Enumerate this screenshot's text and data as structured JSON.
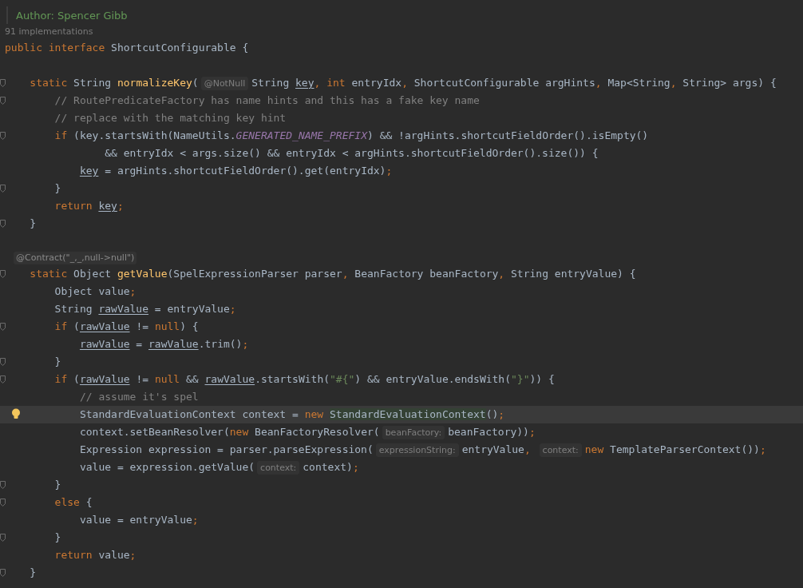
{
  "editor": {
    "lines": [
      {
        "kind": "doc",
        "text": "Author: Spencer Gibb"
      },
      {
        "kind": "lens",
        "text": "91 implementations"
      },
      {
        "kind": "code",
        "fold": false,
        "current": false,
        "bulb": false,
        "tokens": [
          {
            "text": "public interface",
            "kind": "kw"
          },
          {
            "text": " ShortcutConfigurable {",
            "kind": "p"
          }
        ]
      },
      {
        "kind": "blank"
      },
      {
        "kind": "code",
        "fold": true,
        "current": false,
        "bulb": false,
        "tokens": [
          {
            "text": "    static",
            "kind": "kw"
          },
          {
            "text": " String ",
            "kind": "p"
          },
          {
            "text": "normalizeKey",
            "kind": "fn"
          },
          {
            "text": "(",
            "kind": "p"
          },
          {
            "text": "@NotNull",
            "kind": "hint"
          },
          {
            "text": "String ",
            "kind": "p"
          },
          {
            "text": "key",
            "kind": "var"
          },
          {
            "text": ", ",
            "kind": "kw"
          },
          {
            "text": "int",
            "kind": "kw"
          },
          {
            "text": " entryIdx",
            "kind": "p"
          },
          {
            "text": ",",
            "kind": "kw"
          },
          {
            "text": " ShortcutConfigurable argHints",
            "kind": "p"
          },
          {
            "text": ",",
            "kind": "kw"
          },
          {
            "text": " Map<String",
            "kind": "p"
          },
          {
            "text": ",",
            "kind": "kw"
          },
          {
            "text": " String> args) {",
            "kind": "p"
          }
        ]
      },
      {
        "kind": "code",
        "fold": true,
        "current": false,
        "bulb": false,
        "tokens": [
          {
            "text": "        // RoutePredicateFactory has name hints and this has a fake key name",
            "kind": "cmt"
          }
        ]
      },
      {
        "kind": "code",
        "fold": false,
        "current": false,
        "bulb": false,
        "tokens": [
          {
            "text": "        // replace with the matching key hint",
            "kind": "cmt"
          }
        ]
      },
      {
        "kind": "code",
        "fold": true,
        "current": false,
        "bulb": false,
        "tokens": [
          {
            "text": "        if",
            "kind": "kw"
          },
          {
            "text": " (key.startsWith(NameUtils.",
            "kind": "p"
          },
          {
            "text": "GENERATED_NAME_PREFIX",
            "kind": "const"
          },
          {
            "text": ") && !argHints.shortcutFieldOrder().isEmpty()",
            "kind": "p"
          }
        ]
      },
      {
        "kind": "code",
        "fold": false,
        "current": false,
        "bulb": false,
        "tokens": [
          {
            "text": "                && entryIdx < args.size() && entryIdx < argHints.shortcutFieldOrder().size()) {",
            "kind": "p"
          }
        ]
      },
      {
        "kind": "code",
        "fold": false,
        "current": false,
        "bulb": false,
        "tokens": [
          {
            "text": "            key",
            "kind": "var"
          },
          {
            "text": " = argHints.shortcutFieldOrder().get(entryIdx)",
            "kind": "p"
          },
          {
            "text": ";",
            "kind": "kw"
          }
        ]
      },
      {
        "kind": "code",
        "fold": true,
        "current": false,
        "bulb": false,
        "tokens": [
          {
            "text": "        }",
            "kind": "p"
          }
        ]
      },
      {
        "kind": "code",
        "fold": false,
        "current": false,
        "bulb": false,
        "tokens": [
          {
            "text": "        return ",
            "kind": "kw"
          },
          {
            "text": "key",
            "kind": "var"
          },
          {
            "text": ";",
            "kind": "kw"
          }
        ]
      },
      {
        "kind": "code",
        "fold": true,
        "current": false,
        "bulb": false,
        "tokens": [
          {
            "text": "    }",
            "kind": "p"
          }
        ]
      },
      {
        "kind": "blank"
      },
      {
        "kind": "annotation",
        "text": "@Contract(\"_,_,null->null\")"
      },
      {
        "kind": "code",
        "fold": true,
        "current": false,
        "bulb": false,
        "tokens": [
          {
            "text": "    static",
            "kind": "kw"
          },
          {
            "text": " Object ",
            "kind": "p"
          },
          {
            "text": "getValue",
            "kind": "fn"
          },
          {
            "text": "(SpelExpressionParser parser",
            "kind": "p"
          },
          {
            "text": ",",
            "kind": "kw"
          },
          {
            "text": " BeanFactory beanFactory",
            "kind": "p"
          },
          {
            "text": ",",
            "kind": "kw"
          },
          {
            "text": " String entryValue) {",
            "kind": "p"
          }
        ]
      },
      {
        "kind": "code",
        "fold": false,
        "current": false,
        "bulb": false,
        "tokens": [
          {
            "text": "        Object value",
            "kind": "p"
          },
          {
            "text": ";",
            "kind": "kw"
          }
        ]
      },
      {
        "kind": "code",
        "fold": false,
        "current": false,
        "bulb": false,
        "tokens": [
          {
            "text": "        String ",
            "kind": "p"
          },
          {
            "text": "rawValue",
            "kind": "var"
          },
          {
            "text": " = entryValue",
            "kind": "p"
          },
          {
            "text": ";",
            "kind": "kw"
          }
        ]
      },
      {
        "kind": "code",
        "fold": true,
        "current": false,
        "bulb": false,
        "tokens": [
          {
            "text": "        if",
            "kind": "kw"
          },
          {
            "text": " (",
            "kind": "p"
          },
          {
            "text": "rawValue",
            "kind": "var"
          },
          {
            "text": " != ",
            "kind": "p"
          },
          {
            "text": "null",
            "kind": "kw"
          },
          {
            "text": ") {",
            "kind": "p"
          }
        ]
      },
      {
        "kind": "code",
        "fold": false,
        "current": false,
        "bulb": false,
        "tokens": [
          {
            "text": "            rawValue",
            "kind": "var"
          },
          {
            "text": " = ",
            "kind": "p"
          },
          {
            "text": "rawValue",
            "kind": "var"
          },
          {
            "text": ".trim()",
            "kind": "p"
          },
          {
            "text": ";",
            "kind": "kw"
          }
        ]
      },
      {
        "kind": "code",
        "fold": true,
        "current": false,
        "bulb": false,
        "tokens": [
          {
            "text": "        }",
            "kind": "p"
          }
        ]
      },
      {
        "kind": "code",
        "fold": true,
        "current": false,
        "bulb": false,
        "tokens": [
          {
            "text": "        if",
            "kind": "kw"
          },
          {
            "text": " (",
            "kind": "p"
          },
          {
            "text": "rawValue",
            "kind": "var"
          },
          {
            "text": " != ",
            "kind": "p"
          },
          {
            "text": "null",
            "kind": "kw"
          },
          {
            "text": " && ",
            "kind": "p"
          },
          {
            "text": "rawValue",
            "kind": "var"
          },
          {
            "text": ".startsWith(",
            "kind": "p"
          },
          {
            "text": "\"#{\"",
            "kind": "str"
          },
          {
            "text": ") && entryValue.endsWith(",
            "kind": "p"
          },
          {
            "text": "\"}\"",
            "kind": "str"
          },
          {
            "text": ")) {",
            "kind": "p"
          }
        ]
      },
      {
        "kind": "code",
        "fold": false,
        "current": false,
        "bulb": false,
        "tokens": [
          {
            "text": "            // assume it's spel",
            "kind": "cmt"
          }
        ]
      },
      {
        "kind": "code",
        "fold": false,
        "current": true,
        "bulb": true,
        "tokens": [
          {
            "text": "            StandardEvaluationContext context = ",
            "kind": "p"
          },
          {
            "text": "new ",
            "kind": "kw"
          },
          {
            "text": "StandardEvaluationContext",
            "kind": "usage"
          },
          {
            "text": "()",
            "kind": "p"
          },
          {
            "text": ";",
            "kind": "kw"
          }
        ]
      },
      {
        "kind": "code",
        "fold": false,
        "current": false,
        "bulb": false,
        "tokens": [
          {
            "text": "            context.setBeanResolver(",
            "kind": "p"
          },
          {
            "text": "new",
            "kind": "kw"
          },
          {
            "text": " BeanFactoryResolver(",
            "kind": "p"
          },
          {
            "text": "beanFactory:",
            "kind": "hint"
          },
          {
            "text": "beanFactory))",
            "kind": "p"
          },
          {
            "text": ";",
            "kind": "kw"
          }
        ]
      },
      {
        "kind": "code",
        "fold": false,
        "current": false,
        "bulb": false,
        "tokens": [
          {
            "text": "            Expression expression = parser.parseExpression(",
            "kind": "p"
          },
          {
            "text": "expressionString:",
            "kind": "hint"
          },
          {
            "text": "entryValue",
            "kind": "p"
          },
          {
            "text": ", ",
            "kind": "kw"
          },
          {
            "text": "context:",
            "kind": "hint"
          },
          {
            "text": "new",
            "kind": "kw"
          },
          {
            "text": " TemplateParserContext())",
            "kind": "p"
          },
          {
            "text": ";",
            "kind": "kw"
          }
        ]
      },
      {
        "kind": "code",
        "fold": false,
        "current": false,
        "bulb": false,
        "tokens": [
          {
            "text": "            value = expression.getValue(",
            "kind": "p"
          },
          {
            "text": "context:",
            "kind": "hint"
          },
          {
            "text": "context)",
            "kind": "p"
          },
          {
            "text": ";",
            "kind": "kw"
          }
        ]
      },
      {
        "kind": "code",
        "fold": true,
        "current": false,
        "bulb": false,
        "tokens": [
          {
            "text": "        }",
            "kind": "p"
          }
        ]
      },
      {
        "kind": "code",
        "fold": true,
        "current": false,
        "bulb": false,
        "tokens": [
          {
            "text": "        else",
            "kind": "kw"
          },
          {
            "text": " {",
            "kind": "p"
          }
        ]
      },
      {
        "kind": "code",
        "fold": false,
        "current": false,
        "bulb": false,
        "tokens": [
          {
            "text": "            value = entryValue",
            "kind": "p"
          },
          {
            "text": ";",
            "kind": "kw"
          }
        ]
      },
      {
        "kind": "code",
        "fold": true,
        "current": false,
        "bulb": false,
        "tokens": [
          {
            "text": "        }",
            "kind": "p"
          }
        ]
      },
      {
        "kind": "code",
        "fold": false,
        "current": false,
        "bulb": false,
        "tokens": [
          {
            "text": "        return",
            "kind": "kw"
          },
          {
            "text": " value",
            "kind": "p"
          },
          {
            "text": ";",
            "kind": "kw"
          }
        ]
      },
      {
        "kind": "code",
        "fold": true,
        "current": false,
        "bulb": false,
        "tokens": [
          {
            "text": "    }",
            "kind": "p"
          }
        ]
      }
    ]
  }
}
